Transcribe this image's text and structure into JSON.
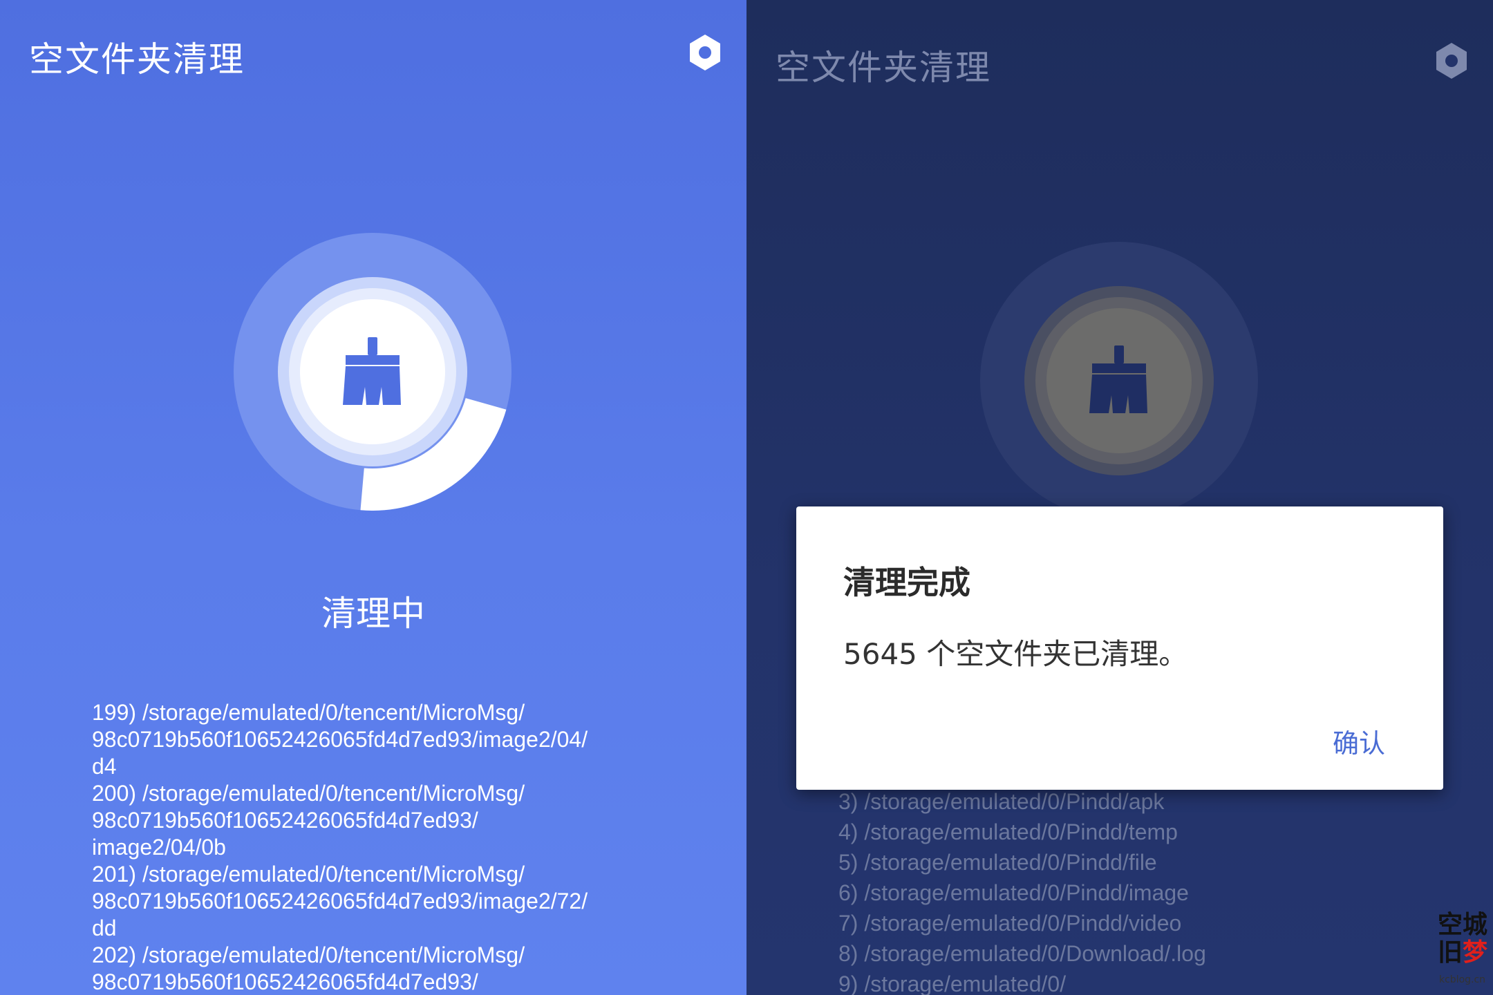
{
  "left": {
    "title": "空文件夹清理",
    "settings_icon": "hexagon-settings-icon",
    "status": "清理中",
    "progress_fraction": 0.22,
    "log": [
      "199) /storage/emulated/0/tencent/MicroMsg/\n98c0719b560f10652426065fd4d7ed93/image2/04/\nd4",
      "200) /storage/emulated/0/tencent/MicroMsg/\n98c0719b560f10652426065fd4d7ed93/\nimage2/04/0b",
      "201) /storage/emulated/0/tencent/MicroMsg/\n98c0719b560f10652426065fd4d7ed93/image2/72/\ndd",
      "202) /storage/emulated/0/tencent/MicroMsg/\n98c0719b560f10652426065fd4d7ed93/"
    ]
  },
  "right": {
    "title": "空文件夹清理",
    "settings_icon": "hexagon-settings-icon",
    "log": [
      "3) /storage/emulated/0/Pindd/apk",
      "4) /storage/emulated/0/Pindd/temp",
      "5) /storage/emulated/0/Pindd/file",
      "6) /storage/emulated/0/Pindd/image",
      "7) /storage/emulated/0/Pindd/video",
      "8) /storage/emulated/0/Download/.log",
      "9) /storage/emulated/0/"
    ],
    "dialog": {
      "title": "清理完成",
      "message": "5645 个空文件夹已清理。",
      "confirm_label": "确认"
    }
  },
  "watermark": {
    "line1": "空城",
    "line2_a": "旧",
    "line2_b": "梦",
    "sub": "kcblog.cn"
  },
  "colors": {
    "left_bg": "#5a7cea",
    "right_bg": "#23336a",
    "accent": "#4a6cd4",
    "broom_left": "#4f6fe0",
    "broom_right": "#1f2e63"
  }
}
